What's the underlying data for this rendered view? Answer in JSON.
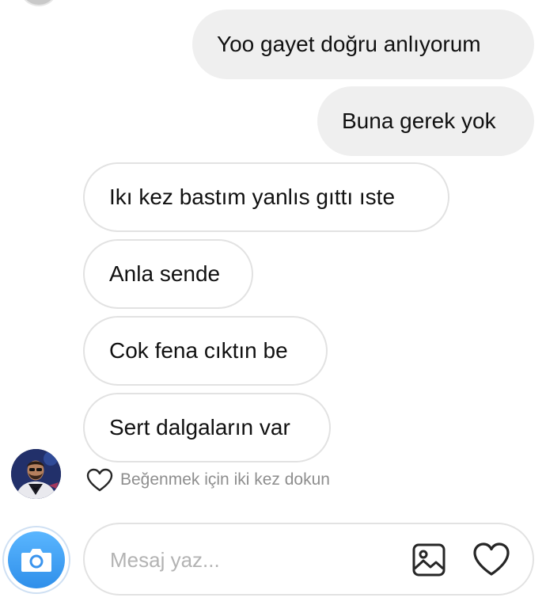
{
  "conversation": {
    "messages": [
      {
        "direction": "outgoing",
        "text": "Yoo gayet doğru anlıyorum"
      },
      {
        "direction": "outgoing",
        "text": "Buna gerek yok"
      },
      {
        "direction": "incoming",
        "text": "Ikı kez bastım yanlıs gıttı ıste"
      },
      {
        "direction": "incoming",
        "text": "Anla sende"
      },
      {
        "direction": "incoming",
        "text": "Cok fena cıktın be"
      },
      {
        "direction": "incoming",
        "text": "Sert dalgaların var"
      }
    ],
    "like_hint": "Beğenmek için iki kez dokun"
  },
  "composer": {
    "placeholder": "Mesaj yaz...",
    "value": ""
  },
  "icons": {
    "camera": "camera-icon",
    "gallery": "image-icon",
    "like": "heart-icon",
    "hint": "heart-outline-icon"
  },
  "colors": {
    "outgoing_bubble": "#efefef",
    "incoming_border": "#e2e2e2",
    "camera_button": "#3897f0",
    "hint_text": "#8e8e8e"
  }
}
